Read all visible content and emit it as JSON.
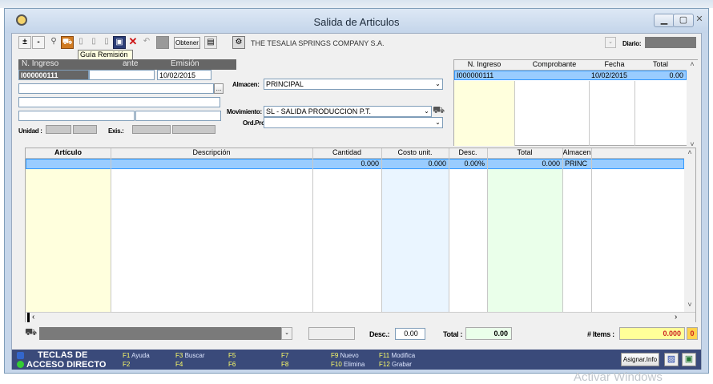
{
  "window": {
    "title": "Salida de Articulos"
  },
  "toolbar": {
    "obtener_label": "Obtener",
    "company_name": "THE TESALIA SPRINGS COMPANY S.A.",
    "tooltip": "Guía Remisión",
    "diario_label": "Diario:",
    "plus_label": "±",
    "minus_label": "-"
  },
  "header": {
    "col_ingreso": "N. Ingreso",
    "col_comprobante": "ante",
    "col_emision": "Emisión",
    "ingreso_value": "I000000111",
    "emision_value": "10/02/2015",
    "ellipsis": "..."
  },
  "form": {
    "almacen_label": "Almacen:",
    "almacen_value": "PRINCIPAL",
    "movimiento_label": "Movimiento:",
    "movimiento_value": "SL   - SALIDA PRODUCCION P.T.",
    "ordprod_label": "Ord.Prod:",
    "ordprod_value": "",
    "unidad_label": "Unidad :",
    "exis_label": "Exis.:"
  },
  "right_grid": {
    "columns": [
      "N. Ingreso",
      "Comprobante",
      "Fecha",
      "Total"
    ],
    "rows": [
      [
        "I000000111",
        "",
        "10/02/2015",
        "0.00"
      ]
    ]
  },
  "items_grid": {
    "columns": [
      "Artículo",
      "Descripción",
      "Cantidad",
      "Costo unit.",
      "Desc.",
      "Total",
      "Almacen"
    ],
    "rows": [
      [
        "",
        "",
        "0.000",
        "0.000",
        "0.00%",
        "0.000",
        "PRINC"
      ]
    ]
  },
  "totals": {
    "desc_label": "Desc.:",
    "desc_value": "0.00",
    "total_label": "Total :",
    "total_value": "0.00",
    "items_label": "# Items :",
    "items_value": "0.000",
    "items_count": "0"
  },
  "footer": {
    "shortcut_title_1": "TECLAS DE",
    "shortcut_title_2": "ACCESO DIRECTO",
    "keys": [
      {
        "key": "F1",
        "label": "Ayuda"
      },
      {
        "key": "F2",
        "label": ""
      },
      {
        "key": "F3",
        "label": "Buscar"
      },
      {
        "key": "F4",
        "label": ""
      },
      {
        "key": "F5",
        "label": ""
      },
      {
        "key": "F6",
        "label": ""
      },
      {
        "key": "F7",
        "label": ""
      },
      {
        "key": "F8",
        "label": ""
      },
      {
        "key": "F9",
        "label": "Nuevo"
      },
      {
        "key": "F10",
        "label": "Elimina"
      },
      {
        "key": "F11",
        "label": "Modifica"
      },
      {
        "key": "F12",
        "label": "Grabar"
      }
    ],
    "asignar_label": "Asignar.Info"
  },
  "watermark": "Activar Windows",
  "colors": {
    "selection": "#99ccff",
    "footer": "#3a4a7a",
    "items_highlight": "#ffff99"
  }
}
